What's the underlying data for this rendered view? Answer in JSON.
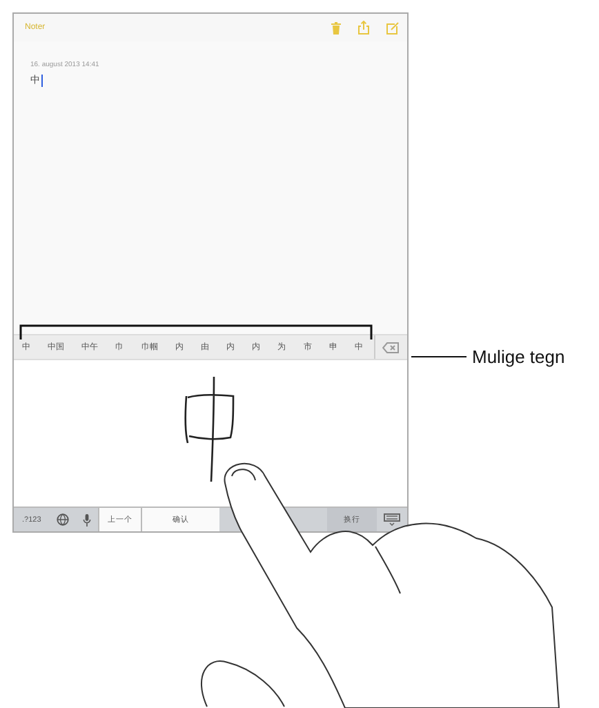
{
  "app": {
    "title": "Noter"
  },
  "note": {
    "date": "16. august 2013 14:41",
    "text": "中"
  },
  "candidates": [
    {
      "label": "中"
    },
    {
      "label": "中国"
    },
    {
      "label": "中午"
    },
    {
      "label": "巾"
    },
    {
      "label": "巾帼"
    },
    {
      "label": "内"
    },
    {
      "label": "由"
    },
    {
      "label": "内"
    },
    {
      "label": "内"
    },
    {
      "label": "为"
    },
    {
      "label": "市"
    },
    {
      "label": "申"
    },
    {
      "label": "中"
    }
  ],
  "keyboard_bar": [
    {
      "kind": "text",
      "label": ".?123"
    },
    {
      "kind": "globe"
    },
    {
      "kind": "mic"
    },
    {
      "kind": "white",
      "label": "上一个"
    },
    {
      "kind": "wide",
      "label": "确认"
    },
    {
      "kind": "text",
      "label": "换行"
    },
    {
      "kind": "hide"
    }
  ],
  "callout": {
    "label": "Mulige tegn"
  }
}
